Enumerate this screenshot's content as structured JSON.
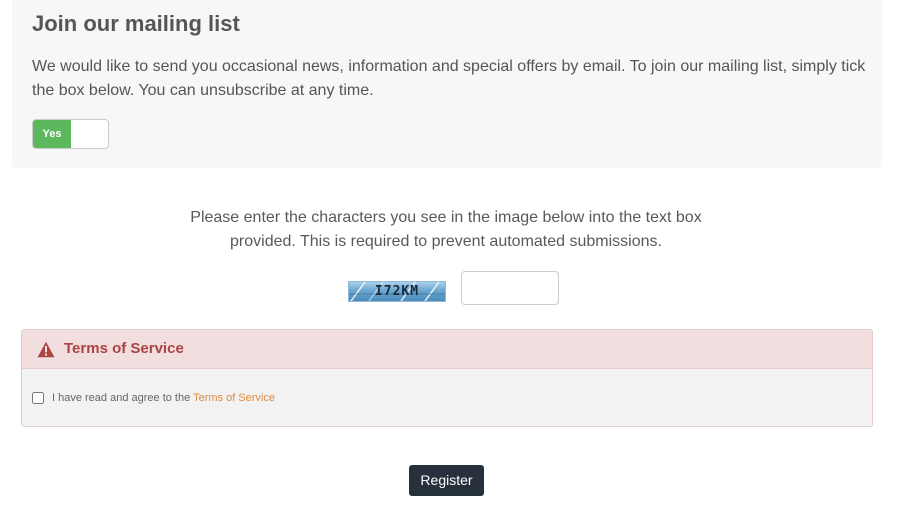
{
  "mailing": {
    "title": "Join our mailing list",
    "description": "We would like to send you occasional news, information and special offers by email. To join our mailing list, simply tick the box below. You can unsubscribe at any time.",
    "toggle_label": "Yes",
    "toggle_state": "on",
    "toggle_color": "#5cb85c"
  },
  "captcha": {
    "instructions": "Please enter the characters you see in the image below into the text box provided. This is required to prevent automated submissions.",
    "image_code": "I72KM",
    "input_value": ""
  },
  "terms": {
    "heading": "Terms of Service",
    "heading_icon": "warning-icon",
    "agree_prefix": "I have read and agree to the",
    "agree_link": "Terms of Service",
    "checked": false,
    "heading_color": "#a94442",
    "link_color": "#e08a3c"
  },
  "actions": {
    "register_label": "Register",
    "button_color": "#26313b"
  }
}
